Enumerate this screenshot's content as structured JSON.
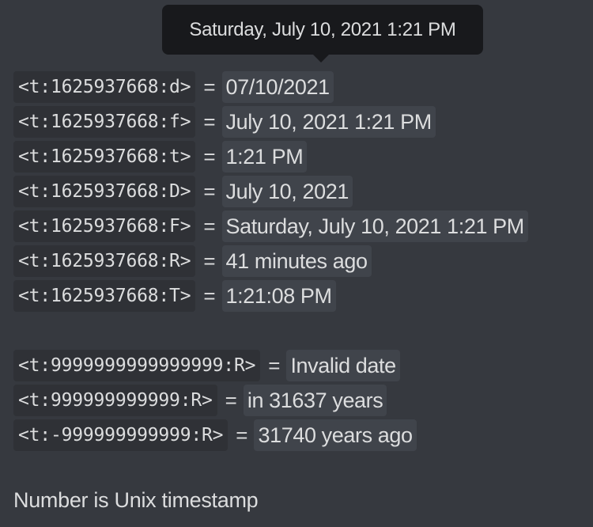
{
  "tooltip": {
    "text": "Saturday, July 10, 2021 1:21 PM"
  },
  "rows": [
    {
      "code": "<t:1625937668:d>",
      "equals": "=",
      "result": "07/10/2021"
    },
    {
      "code": "<t:1625937668:f>",
      "equals": "=",
      "result": "July 10, 2021 1:21 PM"
    },
    {
      "code": "<t:1625937668:t>",
      "equals": "=",
      "result": "1:21 PM"
    },
    {
      "code": "<t:1625937668:D>",
      "equals": "=",
      "result": "July 10, 2021"
    },
    {
      "code": "<t:1625937668:F>",
      "equals": "=",
      "result": "Saturday, July 10, 2021 1:21 PM"
    },
    {
      "code": "<t:1625937668:R>",
      "equals": "=",
      "result": "41 minutes ago"
    },
    {
      "code": "<t:1625937668:T>",
      "equals": "=",
      "result": "1:21:08 PM"
    },
    {
      "code": "<t:9999999999999999:R>",
      "equals": "=",
      "result": "Invalid date"
    },
    {
      "code": "<t:999999999999:R>",
      "equals": "=",
      "result": "in 31637 years"
    },
    {
      "code": "<t:-999999999999:R>",
      "equals": "=",
      "result": "31740 years ago"
    }
  ],
  "footer": {
    "text": "Number is Unix timestamp"
  },
  "colors": {
    "background": "#36393f",
    "code_background": "#2f3136",
    "timestamp_background": "#40444b",
    "tooltip_background": "#18191c",
    "text": "#dcddde"
  }
}
